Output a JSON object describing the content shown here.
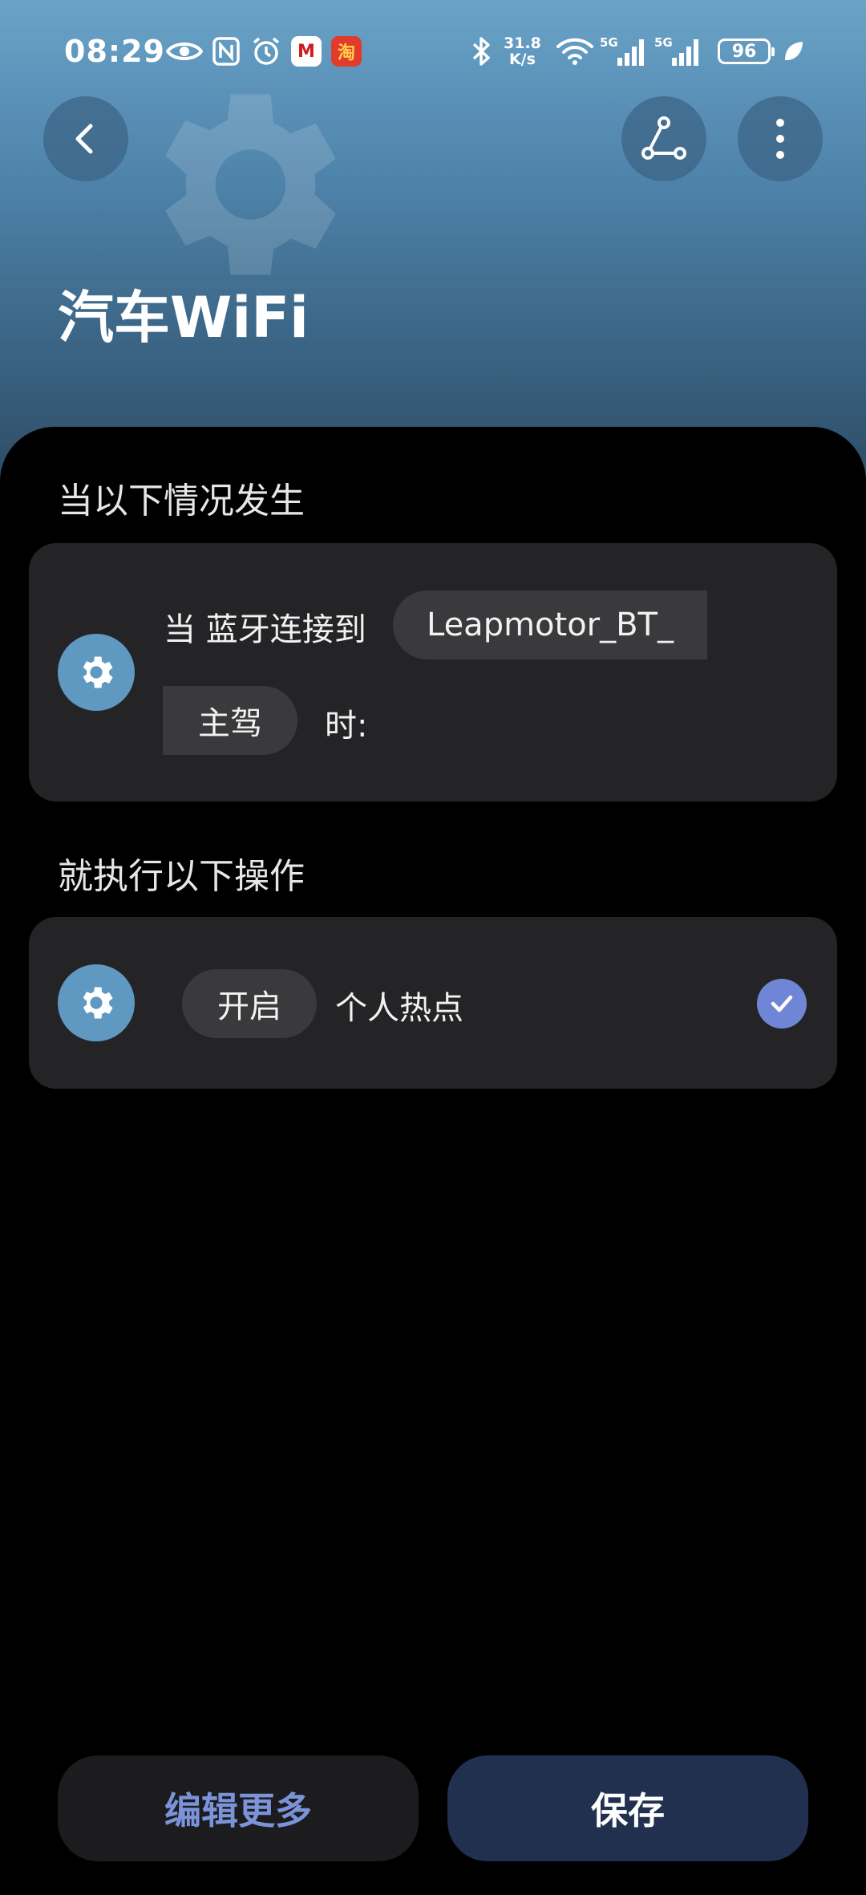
{
  "status_bar": {
    "time": "08:29",
    "net_speed_value": "31.8",
    "net_speed_unit": "K/s",
    "signal1_label": "5G",
    "signal2_label": "5G",
    "battery_level": "96",
    "app_icon_1": "M",
    "app_icon_2": "淘"
  },
  "header": {
    "title": "汽车WiFi"
  },
  "trigger_section": {
    "title": "当以下情况发生",
    "prefix": "当 蓝牙连接到",
    "device_name": "Leapmotor_BT_",
    "device_name_continued": "主驾",
    "suffix": "时:"
  },
  "action_section": {
    "title": "就执行以下操作",
    "action_verb": "开启",
    "action_target": "个人热点",
    "checked": true
  },
  "footer": {
    "edit_more_label": "编辑更多",
    "save_label": "保存"
  },
  "colors": {
    "accent_blue": "#6f86d6",
    "gear_badge": "#5f98c0",
    "card_bg": "#242426",
    "save_bg": "#223050"
  },
  "icons": {
    "back": "chevron-left-icon",
    "flow": "flow-nodes-icon",
    "more": "more-vertical-icon",
    "gear": "gear-icon",
    "check": "check-icon"
  }
}
